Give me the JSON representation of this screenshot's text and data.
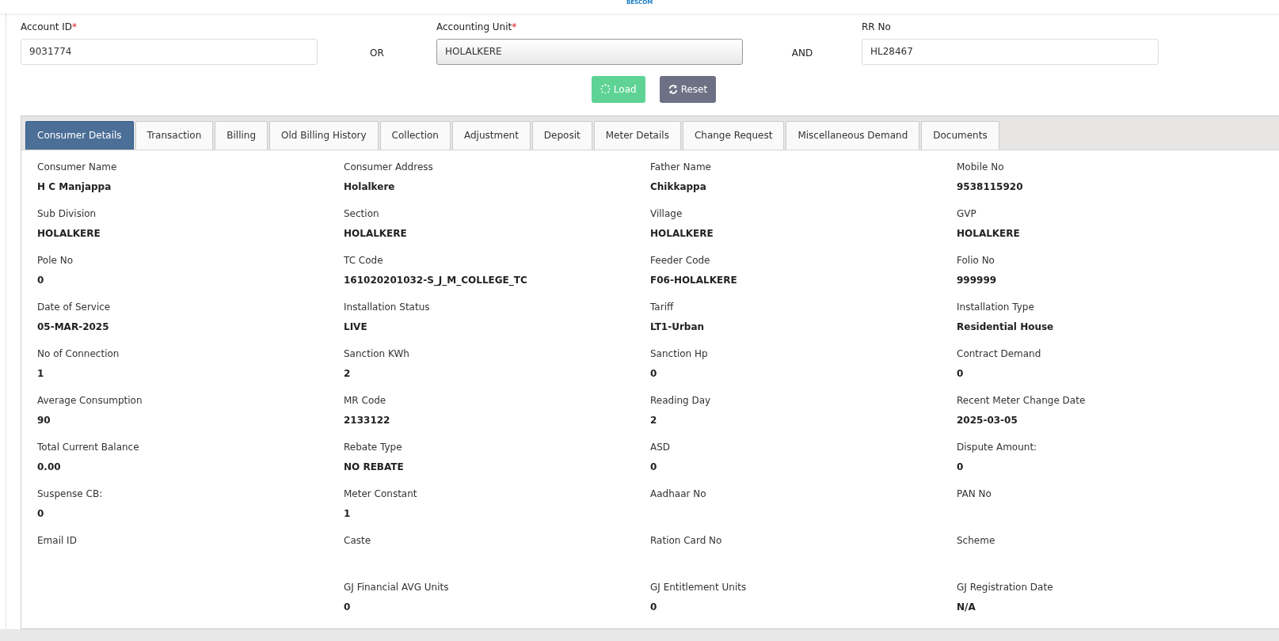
{
  "header": {
    "logo": "BESCOM"
  },
  "search": {
    "fields": [
      {
        "label": "Account ID",
        "required_mark": "*",
        "value": "9031774",
        "kind": "text"
      },
      {
        "kind": "joiner",
        "text": "OR"
      },
      {
        "label": "Accounting Unit",
        "required_mark": "*",
        "value": "HOLALKERE",
        "kind": "select"
      },
      {
        "kind": "joiner",
        "text": "AND"
      },
      {
        "label": "RR No",
        "value": "HL28467",
        "kind": "text"
      }
    ],
    "buttons": [
      {
        "label": "Load",
        "kind": "load"
      },
      {
        "label": "Reset",
        "kind": "reset"
      }
    ]
  },
  "tabs": [
    {
      "label": "Consumer Details",
      "selected": true
    },
    {
      "label": "Transaction",
      "selected": false
    },
    {
      "label": "Billing",
      "selected": false
    },
    {
      "label": "Old Billing History",
      "selected": false
    },
    {
      "label": "Collection",
      "selected": false
    },
    {
      "label": "Adjustment",
      "selected": false
    },
    {
      "label": "Deposit",
      "selected": false
    },
    {
      "label": "Meter Details",
      "selected": false
    },
    {
      "label": "Change Request",
      "selected": false
    },
    {
      "label": "Miscellaneous Demand",
      "selected": false
    },
    {
      "label": "Documents",
      "selected": false
    }
  ],
  "details": [
    [
      {
        "label": "Consumer Name",
        "value": "H C Manjappa"
      },
      {
        "label": "Consumer Address",
        "value": "Holalkere"
      },
      {
        "label": "Father Name",
        "value": "Chikkappa"
      },
      {
        "label": "Mobile No",
        "value": "9538115920"
      }
    ],
    [
      {
        "label": "Sub Division",
        "value": "HOLALKERE"
      },
      {
        "label": "Section",
        "value": "HOLALKERE"
      },
      {
        "label": "Village",
        "value": "HOLALKERE"
      },
      {
        "label": "GVP",
        "value": "HOLALKERE"
      }
    ],
    [
      {
        "label": "Pole No",
        "value": "0"
      },
      {
        "label": "TC Code",
        "value": "161020201032-S_J_M_COLLEGE_TC"
      },
      {
        "label": "Feeder Code",
        "value": "F06-HOLALKERE"
      },
      {
        "label": "Folio No",
        "value": "999999"
      }
    ],
    [
      {
        "label": "Date of Service",
        "value": "05-MAR-2025"
      },
      {
        "label": "Installation Status",
        "value": "LIVE"
      },
      {
        "label": "Tariff",
        "value": "LT1-Urban"
      },
      {
        "label": "Installation Type",
        "value": "Residential House"
      }
    ],
    [
      {
        "label": "No of Connection",
        "value": "1"
      },
      {
        "label": "Sanction KWh",
        "value": "2"
      },
      {
        "label": "Sanction Hp",
        "value": "0"
      },
      {
        "label": "Contract Demand",
        "value": "0"
      }
    ],
    [
      {
        "label": "Average Consumption",
        "value": "90"
      },
      {
        "label": "MR Code",
        "value": "2133122"
      },
      {
        "label": "Reading Day",
        "value": "2"
      },
      {
        "label": "Recent Meter Change Date",
        "value": "2025-03-05"
      }
    ],
    [
      {
        "label": "Total Current Balance",
        "value": "0.00"
      },
      {
        "label": "Rebate Type",
        "value": "NO REBATE"
      },
      {
        "label": "ASD",
        "value": "0"
      },
      {
        "label": "Dispute Amount:",
        "value": "0"
      }
    ],
    [
      {
        "label": "Suspense CB:",
        "value": "0"
      },
      {
        "label": "Meter Constant",
        "value": "1"
      },
      {
        "label": "Aadhaar No"
      },
      {
        "label": "PAN No"
      }
    ],
    [
      {
        "label": "Email ID"
      },
      {
        "label": "Caste"
      },
      {
        "label": "Ration Card No"
      },
      {
        "label": "Scheme"
      }
    ],
    [
      {
        "label": "GJ Financial AVG Units",
        "value": "0"
      },
      {
        "label": "GJ Entitlement Units",
        "value": "0"
      },
      {
        "label": "GJ Registration Date",
        "value": "N/A"
      }
    ]
  ]
}
